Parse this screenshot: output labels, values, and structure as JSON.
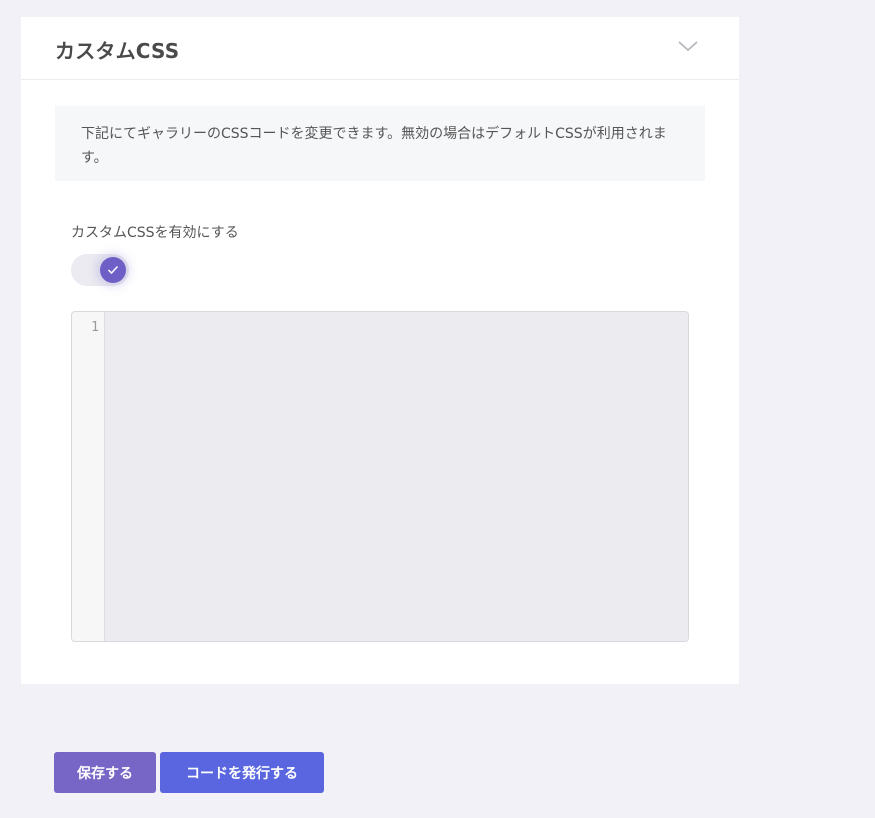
{
  "panel": {
    "title": "カスタムCSS",
    "info_text": "下記にてギャラリーのCSSコードを変更できます。無効の場合はデフォルトCSSが利用されます。"
  },
  "toggle": {
    "label": "カスタムCSSを有効にする",
    "enabled": true
  },
  "editor": {
    "line_numbers": [
      "1"
    ],
    "content": ""
  },
  "buttons": {
    "save_label": "保存する",
    "issue_label": "コードを発行する"
  },
  "colors": {
    "accent": "#6e5fc6",
    "save_button": "#7766c6",
    "issue_button": "#5a66df",
    "background": "#f1f1f7"
  },
  "icons": {
    "collapse": "chevron-down-icon",
    "toggle_check": "check-icon"
  }
}
